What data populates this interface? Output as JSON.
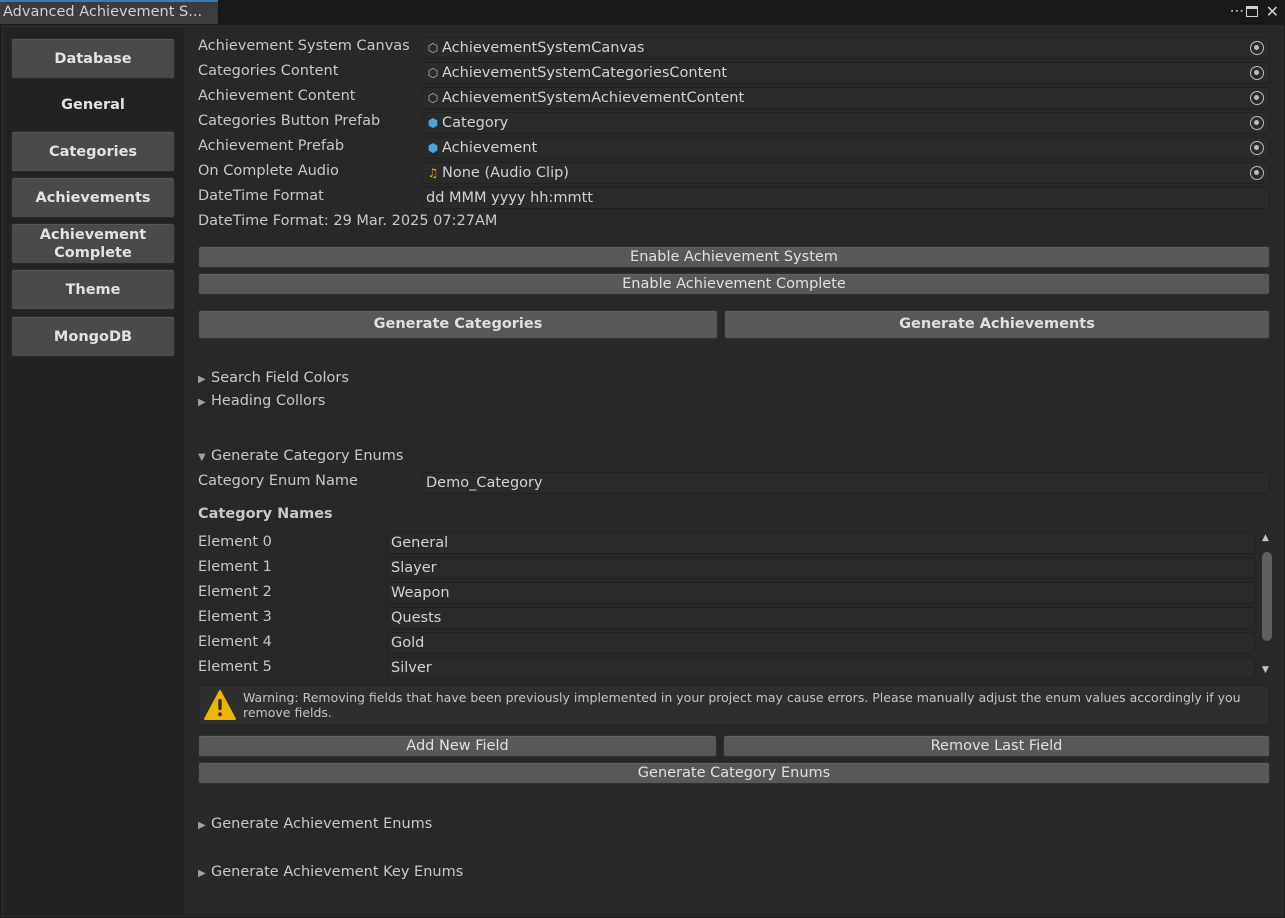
{
  "window": {
    "tab_title": "Advanced Achievement S...",
    "menu_icon": "kebab-menu-icon",
    "maximize_icon": "maximize-icon",
    "close_icon": "close-icon"
  },
  "sidebar": {
    "items": [
      {
        "label": "Database",
        "active": false
      },
      {
        "label": "General",
        "active": true
      },
      {
        "label": "Categories",
        "active": false
      },
      {
        "label": "Achievements",
        "active": false
      },
      {
        "label": "Achievement Complete",
        "active": false
      },
      {
        "label": "Theme",
        "active": false
      },
      {
        "label": "MongoDB",
        "active": false
      }
    ]
  },
  "fields": [
    {
      "label": "Achievement System Canvas",
      "value": "AchievementSystemCanvas",
      "icon": "gameobject-icon"
    },
    {
      "label": "Categories Content",
      "value": "AchievementSystemCategoriesContent",
      "icon": "gameobject-icon"
    },
    {
      "label": "Achievement Content",
      "value": "AchievementSystemAchievementContent",
      "icon": "gameobject-icon"
    },
    {
      "label": "Categories Button Prefab",
      "value": "Category",
      "icon": "prefab-icon"
    },
    {
      "label": "Achievement Prefab",
      "value": "Achievement",
      "icon": "prefab-icon"
    },
    {
      "label": "On Complete Audio",
      "value": "None (Audio Clip)",
      "icon": "audio-clip-icon"
    }
  ],
  "datetime": {
    "label": "DateTime Format",
    "value": "dd MMM yyyy hh:mmtt",
    "preview": "DateTime Format: 29 Mar. 2025 07:27AM"
  },
  "buttons": {
    "enable_system": "Enable Achievement System",
    "enable_complete": "Enable Achievement Complete",
    "generate_categories": "Generate Categories",
    "generate_achievements": "Generate Achievements",
    "add_field": "Add New Field",
    "remove_field": "Remove Last Field",
    "generate_category_enums": "Generate Category Enums"
  },
  "foldouts": {
    "search_field_colors": "Search Field Colors",
    "heading_colors": "Heading Collors",
    "generate_category_enums": "Generate Category Enums",
    "generate_achievement_enums": "Generate Achievement Enums",
    "generate_achievement_key_enums": "Generate Achievement Key Enums"
  },
  "category_enum": {
    "name_label": "Category Enum Name",
    "name_value": "Demo_Category",
    "list_title": "Category Names",
    "elements": [
      {
        "label": "Element 0",
        "value": "General"
      },
      {
        "label": "Element 1",
        "value": "Slayer"
      },
      {
        "label": "Element 2",
        "value": "Weapon"
      },
      {
        "label": "Element 3",
        "value": "Quests"
      },
      {
        "label": "Element 4",
        "value": "Gold"
      },
      {
        "label": "Element 5",
        "value": "Silver"
      }
    ],
    "warning": "Warning: Removing fields that have been previously implemented in your project may cause errors. Please manually adjust the enum values accordingly if you remove fields."
  },
  "colors": {
    "accent": "#3a79bb",
    "warning": "#f0b400",
    "prefab": "#4fa3dc",
    "audio": "#e3a92f"
  }
}
